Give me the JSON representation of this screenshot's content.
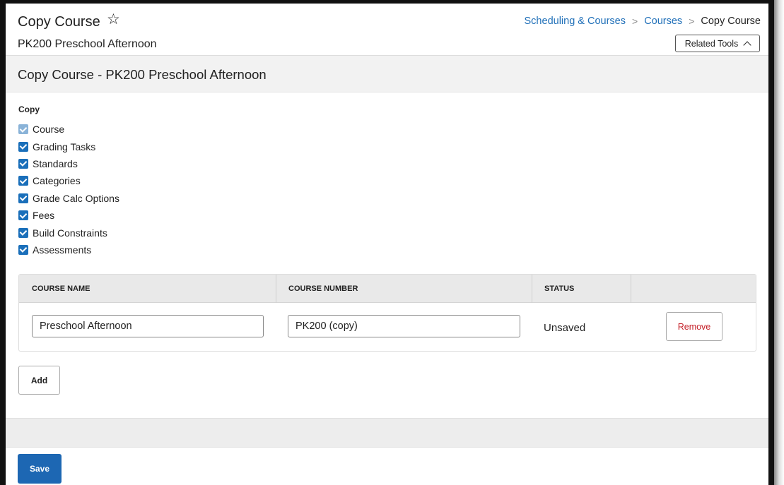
{
  "header": {
    "title": "Copy Course",
    "subtitle": "PK200 Preschool Afternoon",
    "star_icon": "star-outline-icon",
    "breadcrumb": [
      "Scheduling & Courses",
      "Courses",
      "Copy Course"
    ],
    "breadcrumb_separator": ">",
    "related_tools_label": "Related Tools"
  },
  "section": {
    "title": "Copy Course - PK200 Preschool Afternoon"
  },
  "copy": {
    "label": "Copy",
    "options": [
      {
        "label": "Course",
        "checked": true,
        "disabled": true
      },
      {
        "label": "Grading Tasks",
        "checked": true,
        "disabled": false
      },
      {
        "label": "Standards",
        "checked": true,
        "disabled": false
      },
      {
        "label": "Categories",
        "checked": true,
        "disabled": false
      },
      {
        "label": "Grade Calc Options",
        "checked": true,
        "disabled": false
      },
      {
        "label": "Fees",
        "checked": true,
        "disabled": false
      },
      {
        "label": "Build Constraints",
        "checked": true,
        "disabled": false
      },
      {
        "label": "Assessments",
        "checked": true,
        "disabled": false
      }
    ]
  },
  "table": {
    "columns": [
      "COURSE NAME",
      "COURSE NUMBER",
      "STATUS",
      ""
    ],
    "rows": [
      {
        "course_name": "Preschool Afternoon",
        "course_number": "PK200 (copy)",
        "status": "Unsaved",
        "action_label": "Remove"
      }
    ]
  },
  "actions": {
    "add_label": "Add",
    "save_label": "Save"
  },
  "colors": {
    "accent": "#1d67b3",
    "link": "#1f6fb8",
    "danger": "#c5222a",
    "section_bg": "#f2f2f2"
  }
}
